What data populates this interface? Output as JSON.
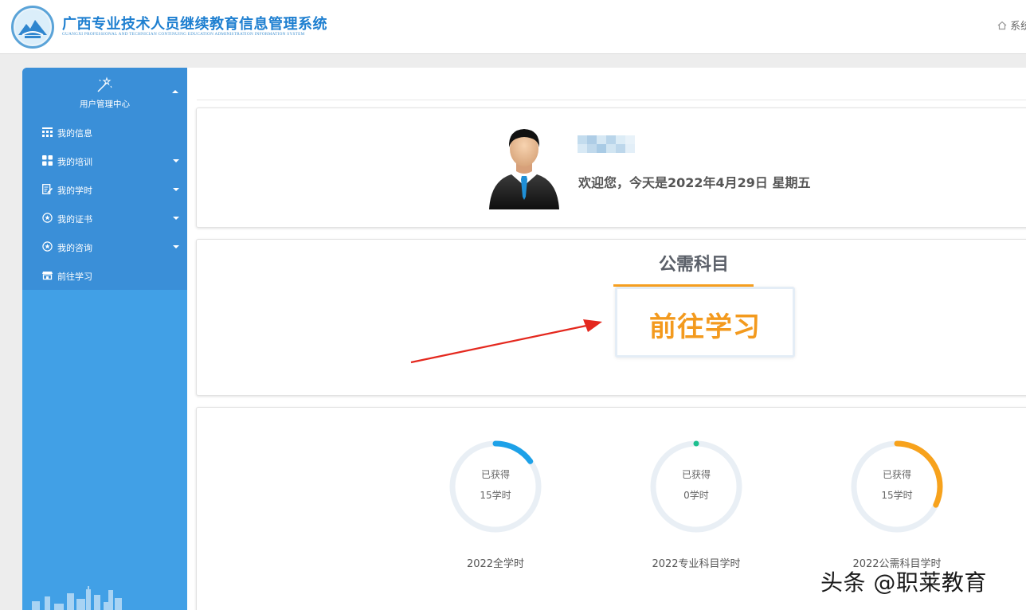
{
  "header": {
    "title": "广西专业技术人员继续教育信息管理系统",
    "subtitle": "GUANGXI PROFESSIONAL AND TECHNICIAN CONTINUING EDUCATION ADMINISTRATION INFORMATION SYSTEM",
    "home_link": "系统"
  },
  "sidebar": {
    "section_label": "用户管理中心",
    "items": [
      {
        "label": "我的信息",
        "icon": "grid-icon",
        "has_submenu": false
      },
      {
        "label": "我的培训",
        "icon": "apps-icon",
        "has_submenu": true
      },
      {
        "label": "我的学时",
        "icon": "edit-doc-icon",
        "has_submenu": true
      },
      {
        "label": "我的证书",
        "icon": "badge-icon",
        "has_submenu": true
      },
      {
        "label": "我的咨询",
        "icon": "badge-icon",
        "has_submenu": true
      },
      {
        "label": "前往学习",
        "icon": "store-icon",
        "has_submenu": false
      }
    ]
  },
  "welcome": {
    "text": "欢迎您，今天是2022年4月29日 星期五"
  },
  "course": {
    "title": "公需科目",
    "button_label": "前往学习"
  },
  "stats": [
    {
      "line1": "已获得",
      "line2": "15学时",
      "caption": "2022全学时",
      "color": "#1da1e8",
      "progress": 0.15
    },
    {
      "line1": "已获得",
      "line2": "0学时",
      "caption": "2022专业科目学时",
      "color": "#1dbf8f",
      "progress": 0
    },
    {
      "line1": "已获得",
      "line2": "15学时",
      "caption": "2022公需科目学时",
      "color": "#f7a21c",
      "progress": 0.32
    }
  ],
  "watermark": "头条 @职莱教育",
  "colors": {
    "sidebar": "#41a0e6",
    "accent_orange": "#f39a1e",
    "ring_track": "#e9eff5"
  }
}
